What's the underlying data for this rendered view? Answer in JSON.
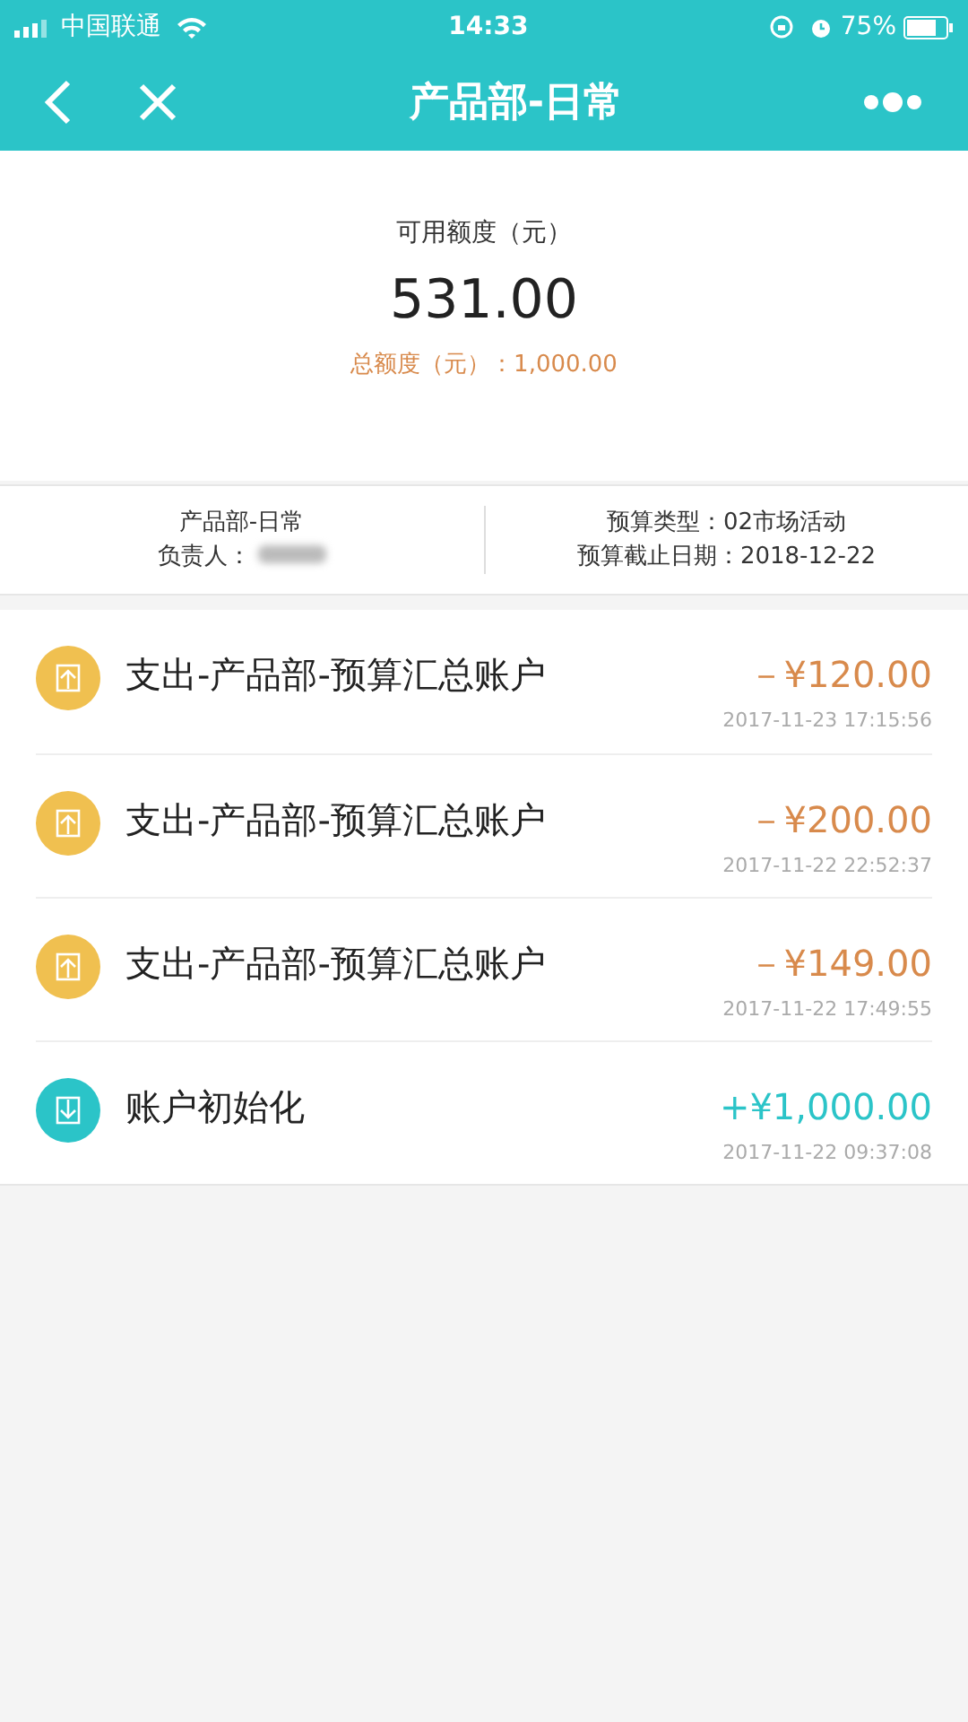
{
  "status_bar": {
    "carrier": "中国联通",
    "time": "14:33",
    "battery": "75%"
  },
  "nav": {
    "title": "产品部-日常"
  },
  "balance": {
    "label": "可用额度（元）",
    "amount": "531.00",
    "total": "总额度（元）：1,000.00"
  },
  "info": {
    "name": "产品部-日常",
    "owner_label": "负责人：",
    "owner_redacted": true,
    "type": "预算类型：02市场活动",
    "deadline": "预算截止日期：2018-12-22"
  },
  "transactions": [
    {
      "kind": "expense",
      "title": "支出-产品部-预算汇总账户",
      "amount": "－¥120.00",
      "time": "2017-11-23 17:15:56"
    },
    {
      "kind": "expense",
      "title": "支出-产品部-预算汇总账户",
      "amount": "－¥200.00",
      "time": "2017-11-22 22:52:37"
    },
    {
      "kind": "expense",
      "title": "支出-产品部-预算汇总账户",
      "amount": "－¥149.00",
      "time": "2017-11-22 17:49:55"
    },
    {
      "kind": "income",
      "title": "账户初始化",
      "amount": "+¥1,000.00",
      "time": "2017-11-22 09:37:08"
    }
  ]
}
